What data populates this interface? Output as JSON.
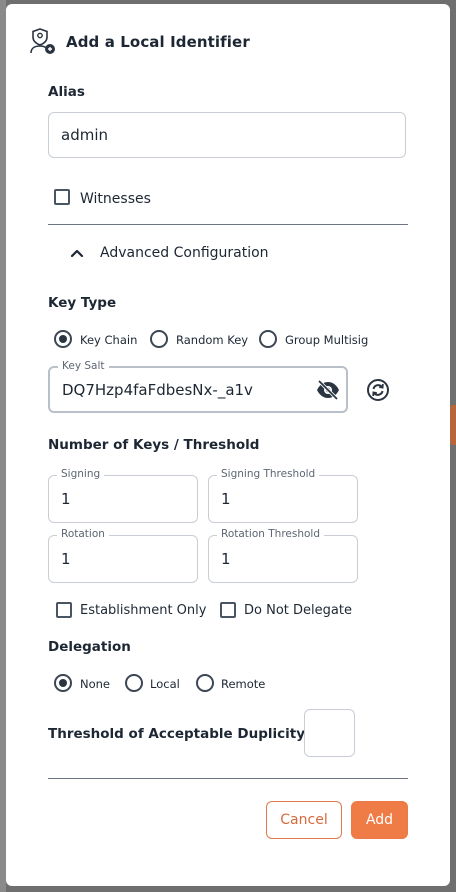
{
  "dialog": {
    "title": "Add a Local Identifier",
    "alias": {
      "label": "Alias",
      "value": "admin"
    },
    "witnesses": {
      "label": "Witnesses",
      "checked": false
    },
    "advanced": {
      "label": "Advanced Configuration",
      "expanded": true
    },
    "key_type": {
      "label": "Key Type",
      "options": [
        {
          "label": "Key Chain",
          "selected": true
        },
        {
          "label": "Random Key",
          "selected": false
        },
        {
          "label": "Group Multisig",
          "selected": false
        }
      ]
    },
    "key_salt": {
      "label": "Key Salt",
      "value": "DQ7Hzp4faFdbesNx-_a1v"
    },
    "keys": {
      "label": "Number of Keys / Threshold",
      "signing": {
        "label": "Signing",
        "value": "1"
      },
      "signing_threshold": {
        "label": "Signing Threshold",
        "value": "1"
      },
      "rotation": {
        "label": "Rotation",
        "value": "1"
      },
      "rotation_threshold": {
        "label": "Rotation Threshold",
        "value": "1"
      }
    },
    "establishment_only": {
      "label": "Establishment Only",
      "checked": false
    },
    "do_not_delegate": {
      "label": "Do Not Delegate",
      "checked": false
    },
    "delegation": {
      "label": "Delegation",
      "options": [
        {
          "label": "None",
          "selected": true
        },
        {
          "label": "Local",
          "selected": false
        },
        {
          "label": "Remote",
          "selected": false
        }
      ]
    },
    "duplicity": {
      "label": "Threshold of Acceptable Duplicity",
      "value": ""
    },
    "buttons": {
      "cancel": "Cancel",
      "add": "Add"
    }
  },
  "colors": {
    "accent": "#ef7b46",
    "accent_text": "#d76a3c",
    "text": "#1d2733",
    "border": "#c9ced6"
  }
}
